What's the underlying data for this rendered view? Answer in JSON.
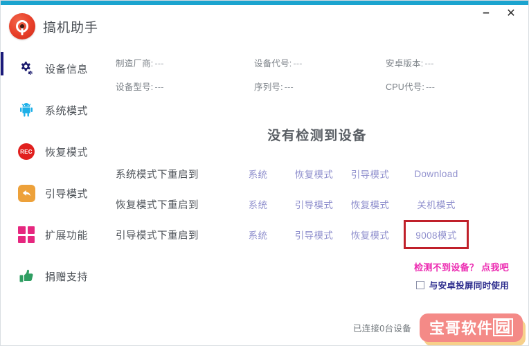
{
  "window": {
    "accent_color": "#1ba4cf",
    "minimize_label": "–",
    "close_label": "✕"
  },
  "brand": {
    "title": "搞机助手",
    "logo_icon": "app-logo-icon"
  },
  "sidebar": {
    "items": [
      {
        "label": "设备信息",
        "icon": "gear-icon",
        "active": true
      },
      {
        "label": "系统模式",
        "icon": "android-icon",
        "active": false
      },
      {
        "label": "恢复模式",
        "icon": "rec-icon",
        "active": false
      },
      {
        "label": "引导模式",
        "icon": "back-arrow-icon",
        "active": false
      },
      {
        "label": "扩展功能",
        "icon": "grid-icon",
        "active": false
      },
      {
        "label": "捐赠支持",
        "icon": "thumbs-up-icon",
        "active": false
      }
    ]
  },
  "device_info": [
    {
      "key": "制造厂商:",
      "value": "---"
    },
    {
      "key": "设备代号:",
      "value": "---"
    },
    {
      "key": "安卓版本:",
      "value": "---"
    },
    {
      "key": "设备型号:",
      "value": "---"
    },
    {
      "key": "序列号:",
      "value": "---"
    },
    {
      "key": "CPU代号:",
      "value": "---"
    }
  ],
  "main": {
    "headline": "没有检测到设备",
    "link_color": "#8f8fcd",
    "highlight_color": "#c0202a",
    "rows": [
      {
        "label": "系统模式下重启到",
        "links": [
          {
            "text": "系统",
            "highlighted": false
          },
          {
            "text": "恢复模式",
            "highlighted": false
          },
          {
            "text": "引导模式",
            "highlighted": false
          },
          {
            "text": "Download",
            "highlighted": false
          }
        ]
      },
      {
        "label": "恢复模式下重启到",
        "links": [
          {
            "text": "系统",
            "highlighted": false
          },
          {
            "text": "引导模式",
            "highlighted": false
          },
          {
            "text": "恢复模式",
            "highlighted": false
          },
          {
            "text": "关机模式",
            "highlighted": false
          }
        ]
      },
      {
        "label": "引导模式下重启到",
        "links": [
          {
            "text": "系统",
            "highlighted": false
          },
          {
            "text": "引导模式",
            "highlighted": false
          },
          {
            "text": "恢复模式",
            "highlighted": false
          },
          {
            "text": "9008模式",
            "highlighted": true
          }
        ]
      }
    ],
    "helper_link": "检测不到设备？ 点我吧",
    "helper_link_color": "#ec28b0",
    "checkbox": {
      "label": "与安卓投屏同时使用",
      "checked": false
    }
  },
  "status": {
    "text": "已连接0台设备",
    "watermark_prefix": "宝哥软件",
    "watermark_boxed": "园"
  }
}
